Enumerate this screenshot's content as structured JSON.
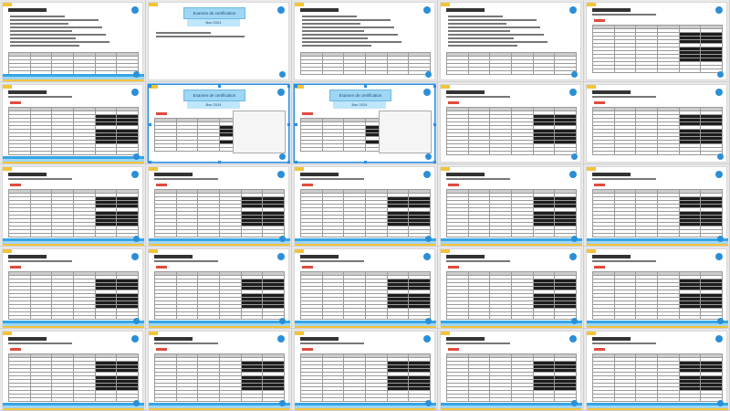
{
  "document": {
    "title_box_label": "Examen de certification",
    "subtitle_box_label": "Bac 2024",
    "section_label": "Retake"
  },
  "pages": [
    {
      "variant": "text"
    },
    {
      "variant": "title"
    },
    {
      "variant": "text"
    },
    {
      "variant": "text"
    },
    {
      "variant": "table"
    },
    {
      "variant": "table"
    },
    {
      "variant": "title-table"
    },
    {
      "variant": "title-table"
    },
    {
      "variant": "table"
    },
    {
      "variant": "table"
    },
    {
      "variant": "table"
    },
    {
      "variant": "table"
    },
    {
      "variant": "table"
    },
    {
      "variant": "table"
    },
    {
      "variant": "table"
    },
    {
      "variant": "table"
    },
    {
      "variant": "table"
    },
    {
      "variant": "table"
    },
    {
      "variant": "table"
    },
    {
      "variant": "table"
    },
    {
      "variant": "table"
    },
    {
      "variant": "table"
    },
    {
      "variant": "table"
    },
    {
      "variant": "table"
    },
    {
      "variant": "table"
    }
  ],
  "colors": {
    "accent_blue": "#35a6e6",
    "title_blue": "#9fd6f4",
    "accent_yellow": "#f2c43a",
    "accent_red": "#e04b3c"
  }
}
